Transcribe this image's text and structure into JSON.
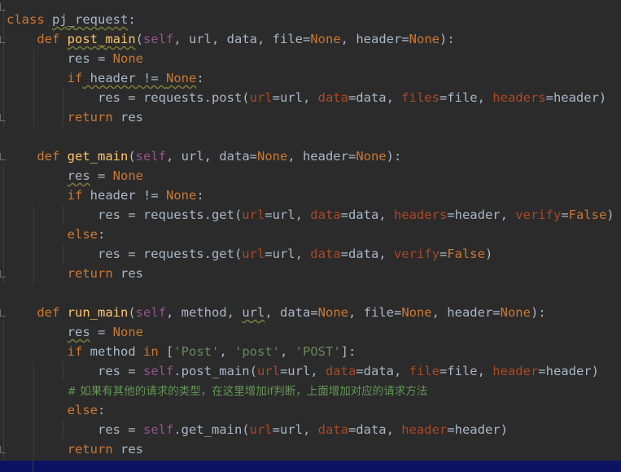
{
  "editor": {
    "lines": [
      [
        {
          "t": "class",
          "c": "kw"
        },
        {
          "t": " "
        },
        {
          "t": "pj_request",
          "w": 1
        },
        {
          "t": ":"
        }
      ],
      [
        {
          "t": "    "
        },
        {
          "t": "def",
          "c": "kw"
        },
        {
          "t": " "
        },
        {
          "t": "post_main",
          "c": "fn",
          "w": 1
        },
        {
          "t": "("
        },
        {
          "t": "self",
          "c": "slf"
        },
        {
          "t": ", url, data, file="
        },
        {
          "t": "None",
          "c": "kw"
        },
        {
          "t": ", header="
        },
        {
          "t": "None",
          "c": "kw"
        },
        {
          "t": "):"
        }
      ],
      [
        {
          "t": "        res = "
        },
        {
          "t": "None",
          "c": "kw"
        }
      ],
      [
        {
          "t": "        "
        },
        {
          "t": "if",
          "c": "kw"
        },
        {
          "t": " header != ",
          "w": 1
        },
        {
          "t": "None",
          "c": "kw",
          "w": 1
        },
        {
          "t": ":"
        }
      ],
      [
        {
          "t": "            res = requests.post("
        },
        {
          "t": "url",
          "c": "prm"
        },
        {
          "t": "=url, "
        },
        {
          "t": "data",
          "c": "prm"
        },
        {
          "t": "=data, "
        },
        {
          "t": "files",
          "c": "prm"
        },
        {
          "t": "=file, "
        },
        {
          "t": "headers",
          "c": "prm"
        },
        {
          "t": "=header)"
        }
      ],
      [
        {
          "t": "        "
        },
        {
          "t": "return",
          "c": "kw"
        },
        {
          "t": " res"
        }
      ],
      [],
      [
        {
          "t": "    "
        },
        {
          "t": "def",
          "c": "kw"
        },
        {
          "t": " "
        },
        {
          "t": "get_main",
          "c": "fn"
        },
        {
          "t": "("
        },
        {
          "t": "self",
          "c": "slf"
        },
        {
          "t": ", url, data="
        },
        {
          "t": "None",
          "c": "kw"
        },
        {
          "t": ", header="
        },
        {
          "t": "None",
          "c": "kw"
        },
        {
          "t": "):"
        }
      ],
      [
        {
          "t": "        "
        },
        {
          "t": "res",
          "w": 1
        },
        {
          "t": " = "
        },
        {
          "t": "None",
          "c": "kw"
        }
      ],
      [
        {
          "t": "        "
        },
        {
          "t": "if",
          "c": "kw"
        },
        {
          "t": " header != "
        },
        {
          "t": "None",
          "c": "kw"
        },
        {
          "t": ":"
        }
      ],
      [
        {
          "t": "            res = requests.get("
        },
        {
          "t": "url",
          "c": "prm"
        },
        {
          "t": "=url, "
        },
        {
          "t": "data",
          "c": "prm"
        },
        {
          "t": "=data, "
        },
        {
          "t": "headers",
          "c": "prm"
        },
        {
          "t": "=header, "
        },
        {
          "t": "verify",
          "c": "prm"
        },
        {
          "t": "="
        },
        {
          "t": "False",
          "c": "kw"
        },
        {
          "t": ")"
        }
      ],
      [
        {
          "t": "        "
        },
        {
          "t": "else",
          "c": "kw"
        },
        {
          "t": ":"
        }
      ],
      [
        {
          "t": "            res = requests.get("
        },
        {
          "t": "url",
          "c": "prm"
        },
        {
          "t": "=url, "
        },
        {
          "t": "data",
          "c": "prm"
        },
        {
          "t": "=data, "
        },
        {
          "t": "verify",
          "c": "prm"
        },
        {
          "t": "="
        },
        {
          "t": "False",
          "c": "kw"
        },
        {
          "t": ")"
        }
      ],
      [
        {
          "t": "        "
        },
        {
          "t": "return",
          "c": "kw"
        },
        {
          "t": " res"
        }
      ],
      [],
      [
        {
          "t": "    "
        },
        {
          "t": "def",
          "c": "kw"
        },
        {
          "t": " "
        },
        {
          "t": "run_main",
          "c": "fn"
        },
        {
          "t": "("
        },
        {
          "t": "self",
          "c": "slf"
        },
        {
          "t": ", method, "
        },
        {
          "t": "url",
          "w": 1
        },
        {
          "t": ", data="
        },
        {
          "t": "None",
          "c": "kw"
        },
        {
          "t": ", file="
        },
        {
          "t": "None",
          "c": "kw"
        },
        {
          "t": ", header="
        },
        {
          "t": "None",
          "c": "kw"
        },
        {
          "t": "):"
        }
      ],
      [
        {
          "t": "        "
        },
        {
          "t": "res",
          "w": 1
        },
        {
          "t": " = "
        },
        {
          "t": "None",
          "c": "kw"
        }
      ],
      [
        {
          "t": "        "
        },
        {
          "t": "if",
          "c": "kw"
        },
        {
          "t": " method "
        },
        {
          "t": "in",
          "c": "kw"
        },
        {
          "t": " ["
        },
        {
          "t": "'Post'",
          "c": "str"
        },
        {
          "t": ", "
        },
        {
          "t": "'post'",
          "c": "str"
        },
        {
          "t": ", "
        },
        {
          "t": "'POST'",
          "c": "str"
        },
        {
          "t": "]:"
        }
      ],
      [
        {
          "t": "            res = "
        },
        {
          "t": "self",
          "c": "slf"
        },
        {
          "t": ".post_main("
        },
        {
          "t": "url",
          "c": "prm"
        },
        {
          "t": "=url, "
        },
        {
          "t": "data",
          "c": "prm"
        },
        {
          "t": "=data, "
        },
        {
          "t": "file",
          "c": "prm"
        },
        {
          "t": "=file, "
        },
        {
          "t": "header",
          "c": "prm"
        },
        {
          "t": "=header)"
        }
      ],
      [
        {
          "t": "        "
        },
        {
          "t": "# 如果有其他的请求的类型，在这里增加if判断，上面增加对应的请求方法",
          "c": "cmt"
        }
      ],
      [
        {
          "t": "        "
        },
        {
          "t": "else",
          "c": "kw"
        },
        {
          "t": ":"
        }
      ],
      [
        {
          "t": "            res = "
        },
        {
          "t": "self",
          "c": "slf"
        },
        {
          "t": ".get_main("
        },
        {
          "t": "url",
          "c": "prm"
        },
        {
          "t": "=url, "
        },
        {
          "t": "data",
          "c": "prm"
        },
        {
          "t": "=data, "
        },
        {
          "t": "header",
          "c": "prm"
        },
        {
          "t": "=header)"
        }
      ],
      [
        {
          "t": "        "
        },
        {
          "t": "return",
          "c": "kw"
        },
        {
          "t": " res"
        }
      ]
    ]
  }
}
